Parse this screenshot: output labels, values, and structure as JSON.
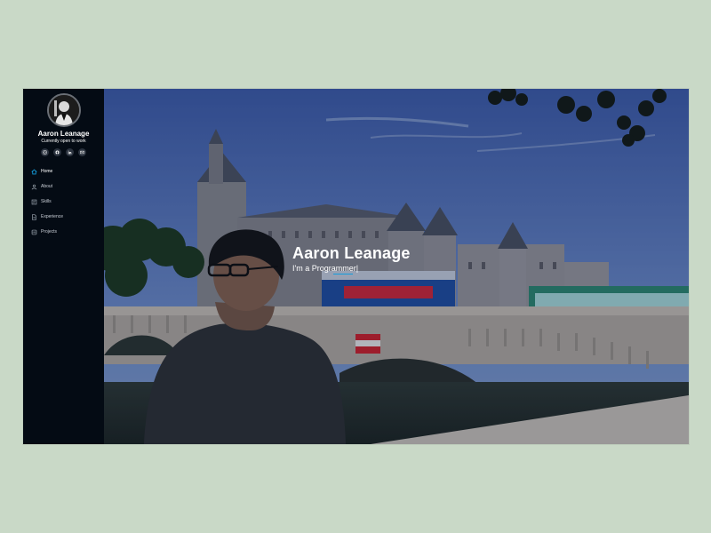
{
  "profile": {
    "name": "Aaron Leanage",
    "status": "Currently open to work"
  },
  "socials": [
    {
      "icon": "instagram-icon",
      "label": "Instagram"
    },
    {
      "icon": "github-icon",
      "label": "GitHub"
    },
    {
      "icon": "linkedin-icon",
      "label": "LinkedIn"
    },
    {
      "icon": "email-icon",
      "label": "Email"
    }
  ],
  "nav": {
    "items": [
      {
        "label": "Home",
        "icon": "home-icon",
        "active": true
      },
      {
        "label": "About",
        "icon": "user-icon",
        "active": false
      },
      {
        "label": "Skills",
        "icon": "skills-icon",
        "active": false
      },
      {
        "label": "Experience",
        "icon": "document-icon",
        "active": false
      },
      {
        "label": "Projects",
        "icon": "projects-icon",
        "active": false
      }
    ]
  },
  "hero": {
    "title": "Aaron Leanage",
    "subtitle": "I'm a Programmer|"
  },
  "colors": {
    "sidebar_bg": "#040b14",
    "accent": "#149ddd",
    "page_bg": "#c9d9c7"
  }
}
